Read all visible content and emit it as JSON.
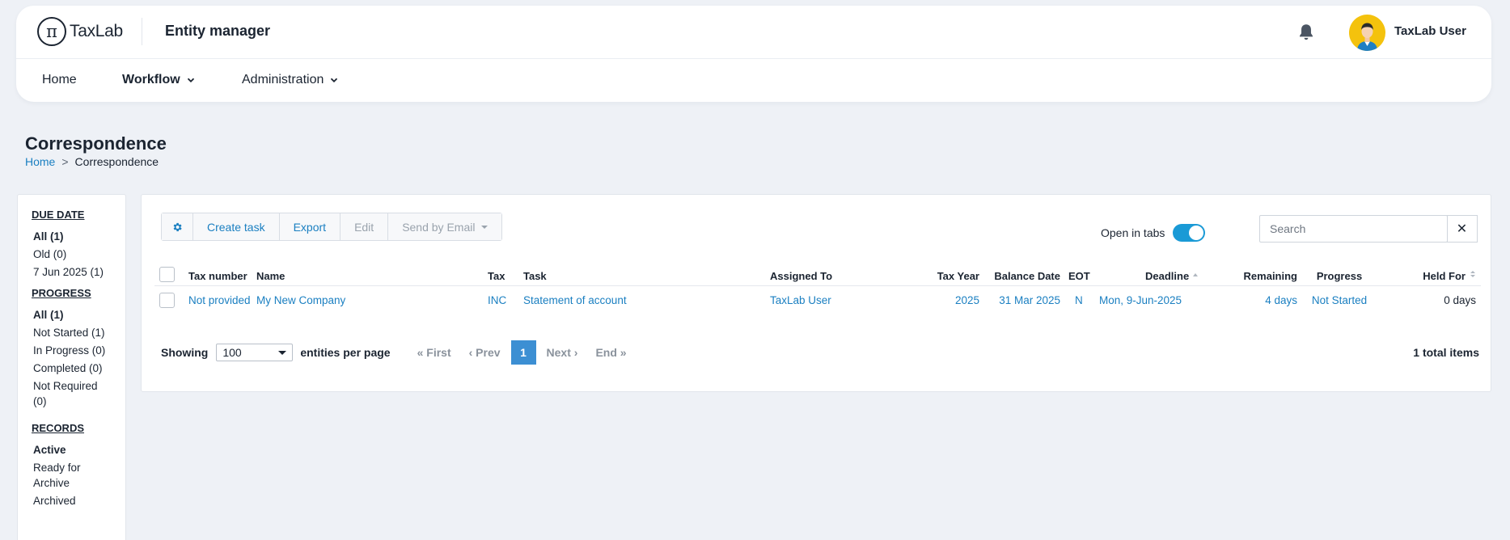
{
  "header": {
    "logo_text": "TaxLab",
    "logo_mark": "π",
    "app_title": "Entity manager",
    "user_name": "TaxLab User"
  },
  "nav": {
    "items": [
      {
        "label": "Home"
      },
      {
        "label": "Workflow"
      },
      {
        "label": "Administration"
      }
    ]
  },
  "page": {
    "title": "Correspondence",
    "breadcrumb": {
      "home": "Home",
      "sep": ">",
      "current": "Correspondence"
    }
  },
  "sidebar": {
    "due_date": {
      "heading": "DUE DATE",
      "items": [
        "All (1)",
        "Old (0)",
        "7 Jun 2025 (1)"
      ]
    },
    "progress": {
      "heading": "PROGRESS",
      "items": [
        "All (1)",
        "Not Started (1)",
        "In Progress (0)",
        "Completed (0)",
        "Not Required (0)"
      ]
    },
    "records": {
      "heading": "RECORDS",
      "items": [
        "Active",
        "Ready for Archive",
        "Archived"
      ]
    }
  },
  "toolbar": {
    "create_task": "Create task",
    "export": "Export",
    "edit": "Edit",
    "send_email": "Send by Email",
    "open_in_tabs": "Open in tabs"
  },
  "search": {
    "placeholder": "Search",
    "clear": "✕"
  },
  "table": {
    "headers": {
      "tax_number": "Tax number",
      "name": "Name",
      "tax": "Tax",
      "task": "Task",
      "assigned_to": "Assigned To",
      "tax_year": "Tax Year",
      "balance_date": "Balance Date",
      "eot": "EOT",
      "deadline": "Deadline",
      "remaining": "Remaining",
      "progress": "Progress",
      "held_for": "Held For"
    },
    "rows": [
      {
        "tax_number": "Not provided",
        "name": "My New Company",
        "tax": "INC",
        "task": "Statement of account",
        "assigned_to": "TaxLab User",
        "tax_year": "2025",
        "balance_date": "31 Mar 2025",
        "eot": "N",
        "deadline": "Mon, 9-Jun-2025",
        "remaining": "4 days",
        "progress": "Not Started",
        "held_for": "0 days"
      }
    ]
  },
  "footer": {
    "showing": "Showing",
    "per_page_value": "100",
    "per_page_label": "entities per page",
    "first": "« First",
    "prev": "‹ Prev",
    "current_page": "1",
    "next": "Next ›",
    "end": "End »",
    "total": "1 total items"
  }
}
